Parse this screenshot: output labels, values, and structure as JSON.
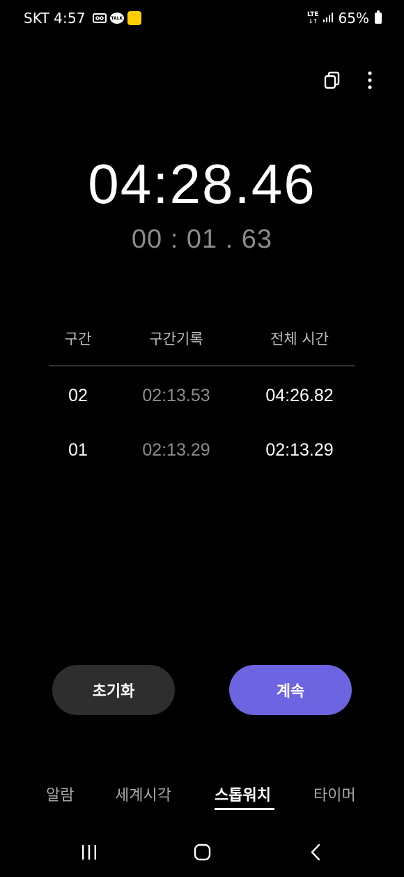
{
  "status_bar": {
    "carrier": "SKT",
    "time": "4:57",
    "talk_label": "TALK",
    "network": "LTE",
    "battery": "65%"
  },
  "stopwatch": {
    "main_time": "04:28.46",
    "lap_time": "00 : 01 . 63"
  },
  "lap_table": {
    "headers": [
      "구간",
      "구간기록",
      "전체 시간"
    ],
    "rows": [
      {
        "lap": "02",
        "split": "02:13.53",
        "total": "04:26.82"
      },
      {
        "lap": "01",
        "split": "02:13.29",
        "total": "02:13.29"
      }
    ]
  },
  "buttons": {
    "reset": "초기화",
    "continue": "계속"
  },
  "tabs": [
    {
      "label": "알람",
      "active": false
    },
    {
      "label": "세계시각",
      "active": false
    },
    {
      "label": "스톱워치",
      "active": true
    },
    {
      "label": "타이머",
      "active": false
    }
  ],
  "colors": {
    "background": "#000000",
    "accent": "#6c64e0",
    "reset_button": "#2e2e2e",
    "muted_text": "#8c8c8c"
  },
  "icons": {
    "top_actions": [
      "copy-icon",
      "more-vert-icon"
    ],
    "nav": [
      "recent-apps-icon",
      "home-icon",
      "back-icon"
    ]
  }
}
